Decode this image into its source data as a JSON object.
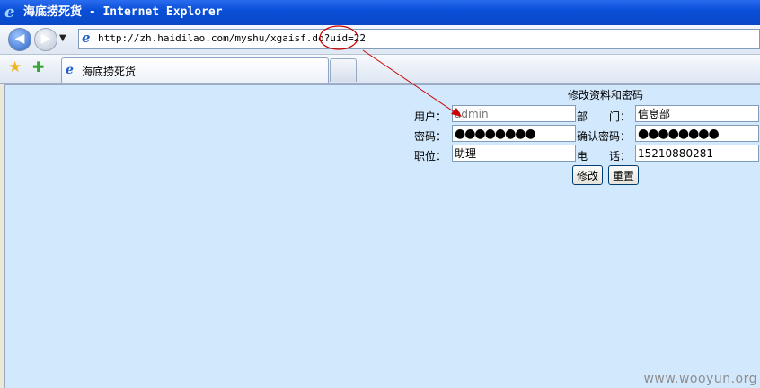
{
  "window": {
    "title": "海底捞死货 - Internet Explorer"
  },
  "address_bar": {
    "url": "http://zh.haidilao.com/myshu/xgaisf.do?uid=22"
  },
  "tabs": [
    {
      "label": "海底捞死货"
    }
  ],
  "form": {
    "title": "修改资料和密码",
    "username_label": "用户：",
    "username_placeholder": "admin",
    "department_label_1": "部",
    "department_label_2": "门：",
    "department_value": "信息部",
    "password_label": "密码：",
    "password_value": "●●●●●●●●",
    "confirm_password_label": "确认密码：",
    "confirm_password_value": "●●●●●●●●",
    "position_label": "职位：",
    "position_value": "助理",
    "phone_label_1": "电",
    "phone_label_2": "话：",
    "phone_value": "15210880281",
    "submit_label": "修改",
    "reset_label": "重置"
  },
  "watermark": "www.wooyun.org",
  "colors": {
    "titlebar": "#0a4fd8",
    "content_bg": "#d2e8fc",
    "annotation": "#cc0000"
  },
  "icons": {
    "browser": "ie-logo-icon",
    "back": "back-arrow-icon",
    "forward": "forward-arrow-icon",
    "favorites": "star-icon",
    "add_favorite": "add-favorite-icon"
  }
}
